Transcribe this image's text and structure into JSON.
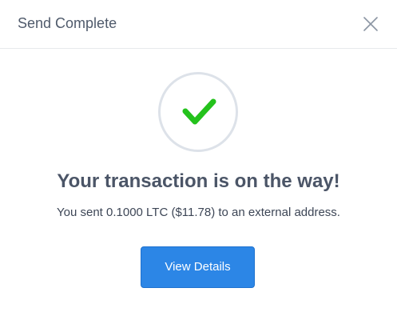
{
  "modal": {
    "title": "Send Complete",
    "close_icon": "close-icon"
  },
  "status": {
    "icon": "checkmark-icon",
    "icon_color": "#24c21c",
    "headline": "Your transaction is on the way!",
    "message": "You sent 0.1000 LTC ($11.78) to an external address."
  },
  "actions": {
    "view_details_label": "View Details",
    "button_color": "#2c86e6"
  }
}
